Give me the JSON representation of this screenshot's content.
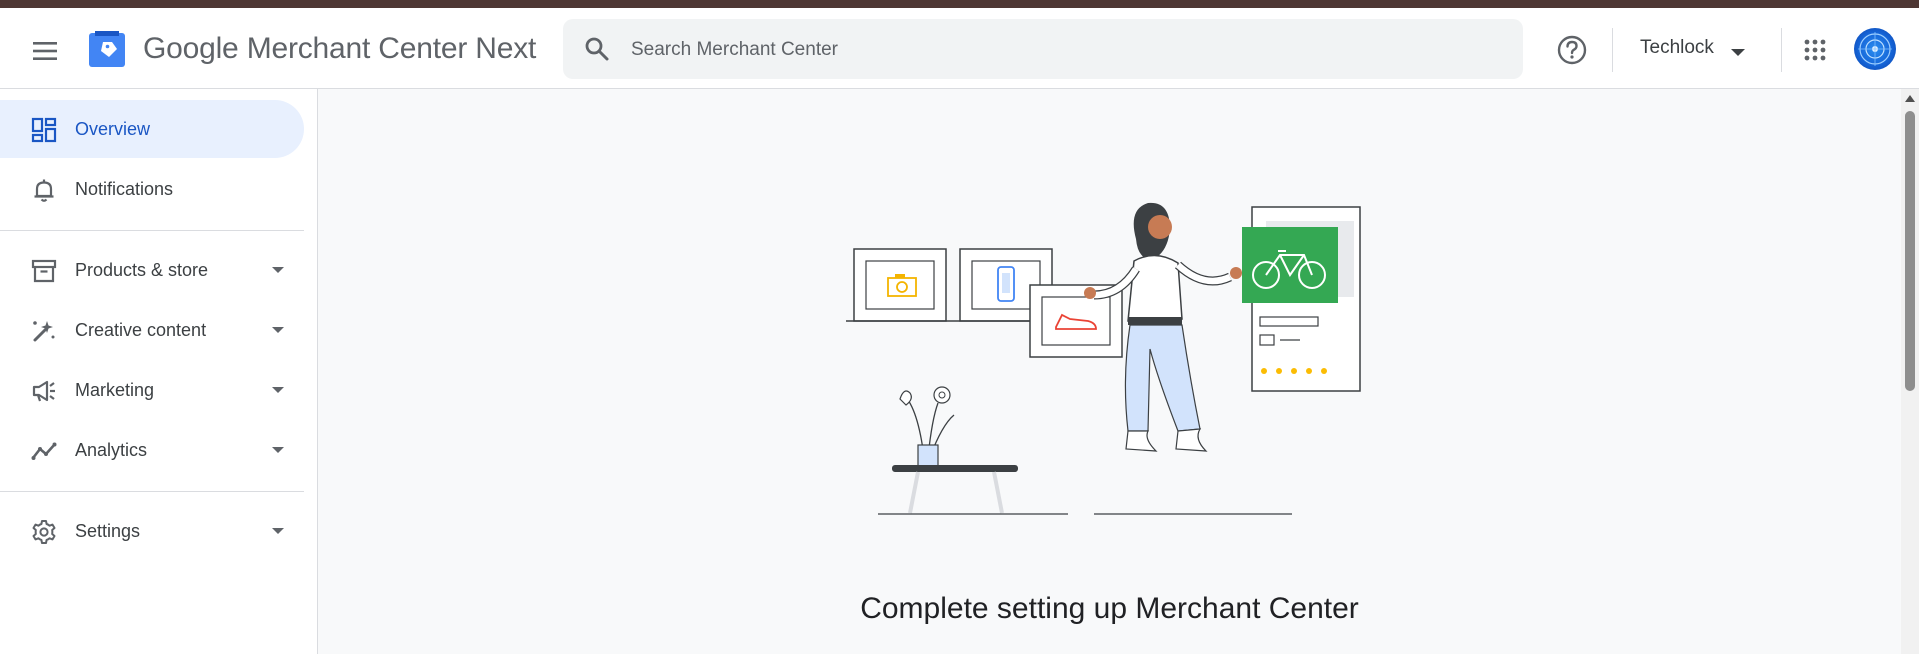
{
  "header": {
    "brand_google": "Google",
    "brand_product": "Merchant Center Next",
    "search_placeholder": "Search Merchant Center",
    "account_name": "Techlock"
  },
  "sidebar": {
    "items": [
      {
        "label": "Overview",
        "icon": "dashboard-icon",
        "active": true
      },
      {
        "label": "Notifications",
        "icon": "bell-icon"
      },
      {
        "label": "Products & store",
        "icon": "store-box-icon",
        "expandable": true
      },
      {
        "label": "Creative content",
        "icon": "brush-sparkle-icon",
        "expandable": true
      },
      {
        "label": "Marketing",
        "icon": "megaphone-icon",
        "expandable": true
      },
      {
        "label": "Analytics",
        "icon": "trend-line-icon",
        "expandable": true
      },
      {
        "label": "Settings",
        "icon": "gear-icon",
        "expandable": true
      }
    ]
  },
  "main": {
    "title": "Complete setting up Merchant Center"
  },
  "colors": {
    "active_bg": "#e8f0fe",
    "active_text": "#1a56c4",
    "main_bg": "#f8f9fa",
    "topstrip": "#4e3734",
    "illustration_green": "#34a853"
  }
}
